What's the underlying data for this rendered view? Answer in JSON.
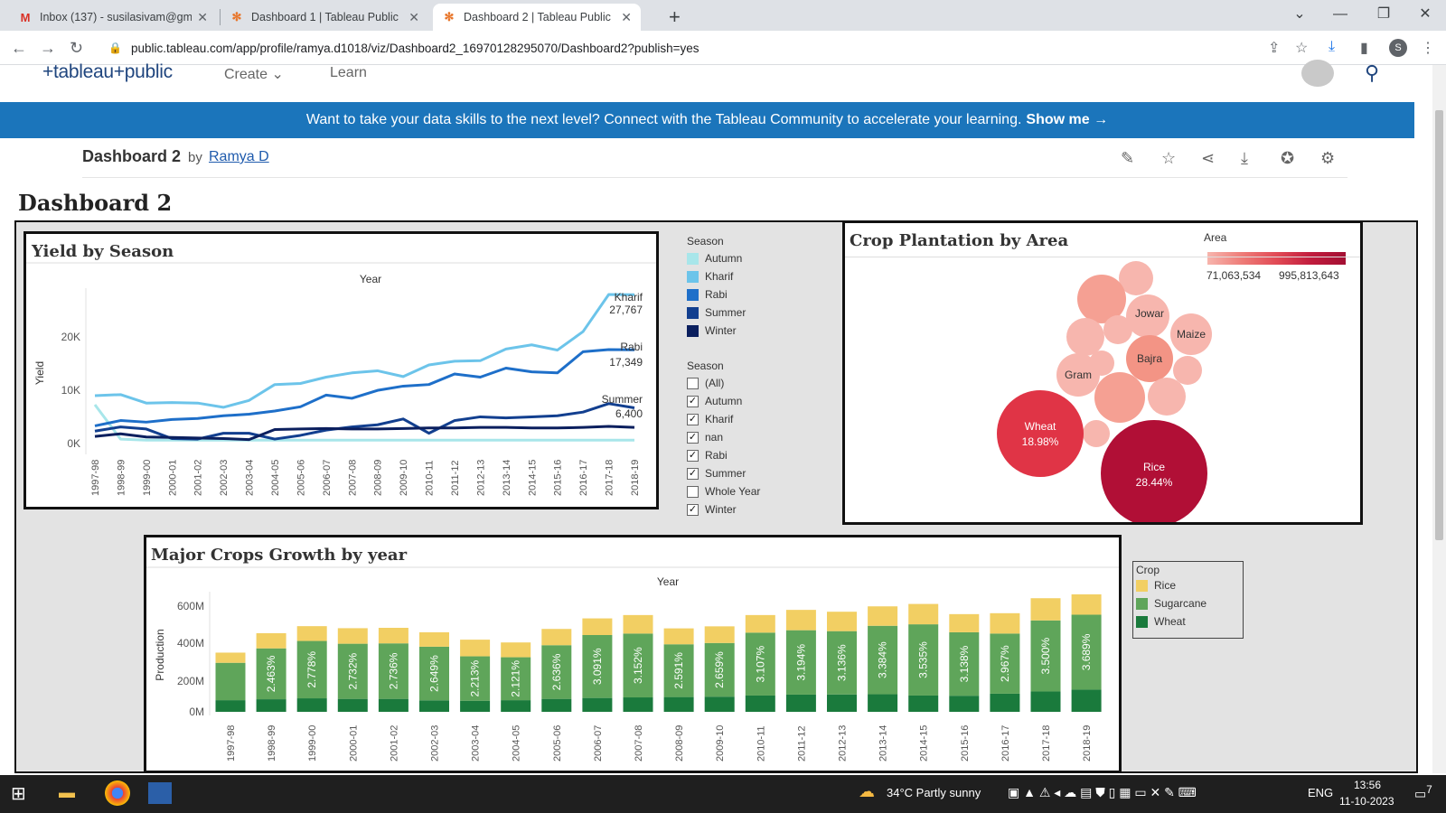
{
  "browser": {
    "tabs": [
      {
        "label": "Inbox (137) - susilasivam@gmail",
        "icon": "gmail-icon",
        "active": false
      },
      {
        "label": "Dashboard 1 | Tableau Public",
        "icon": "tableau-icon",
        "active": false
      },
      {
        "label": "Dashboard 2 | Tableau Public",
        "icon": "tableau-icon",
        "active": true
      }
    ],
    "url": "public.tableau.com/app/profile/ramya.d1018/viz/Dashboard2_16970128295070/Dashboard2?publish=yes",
    "profile_initial": "S"
  },
  "site": {
    "logo": "+tableau+public",
    "nav": [
      "Create",
      "Learn"
    ],
    "banner_text": "Want to take your data skills to the next level? Connect with the Tableau Community to accelerate your learning.",
    "banner_cta": "Show me →"
  },
  "viz": {
    "title": "Dashboard 2",
    "by": "by",
    "author": "Ramya D",
    "dashboard_title": "Dashboard 2"
  },
  "yield_panel": {
    "title": "Yield by Season",
    "axis_title": "Year",
    "ylabel": "Yield",
    "yticks": [
      "20K",
      "10K",
      "0K"
    ],
    "end_labels": [
      {
        "series": "Kharif",
        "name": "Kharif",
        "value": "27,767"
      },
      {
        "series": "Rabi",
        "name": "Rabi",
        "value": "17,349"
      },
      {
        "series": "Summer",
        "name": "Summer",
        "value": "6,400"
      }
    ]
  },
  "season_color_legend": {
    "title": "Season",
    "items": [
      {
        "label": "Autumn",
        "color": "#a8e6ea"
      },
      {
        "label": "Kharif",
        "color": "#6cc4ea"
      },
      {
        "label": "Rabi",
        "color": "#1e6fc9"
      },
      {
        "label": "Summer",
        "color": "#123f8f"
      },
      {
        "label": "Winter",
        "color": "#0b1f5e"
      }
    ]
  },
  "season_filter": {
    "title": "Season",
    "items": [
      {
        "label": "(All)",
        "checked": false
      },
      {
        "label": "Autumn",
        "checked": true
      },
      {
        "label": "Kharif",
        "checked": true
      },
      {
        "label": "nan",
        "checked": true
      },
      {
        "label": "Rabi",
        "checked": true
      },
      {
        "label": "Summer",
        "checked": true
      },
      {
        "label": "Whole Year",
        "checked": false
      },
      {
        "label": "Winter",
        "checked": true
      }
    ]
  },
  "area_panel": {
    "title": "Crop Plantation by Area",
    "legend_title": "Area",
    "legend_min": "71,063,534",
    "legend_max": "995,813,643",
    "labels": {
      "rice_name": "Rice",
      "rice_pct": "28.44%",
      "wheat_name": "Wheat",
      "wheat_pct": "18.98%",
      "jowar": "Jowar",
      "maize": "Maize",
      "bajra": "Bajra",
      "gram": "Gram"
    }
  },
  "crops_panel": {
    "title": "Major Crops Growth by year",
    "axis_title": "Year",
    "ylabel": "Production",
    "yticks": [
      "600M",
      "400M",
      "200M",
      "0M"
    ]
  },
  "crop_legend": {
    "title": "Crop",
    "items": [
      {
        "label": "Rice",
        "color": "#f2cf63"
      },
      {
        "label": "Sugarcane",
        "color": "#5fa55a"
      },
      {
        "label": "Wheat",
        "color": "#1a7a3c"
      }
    ]
  },
  "chart_data": [
    {
      "type": "line",
      "title": "Yield by Season",
      "xlabel": "Year",
      "ylabel": "Yield",
      "ylim": [
        0,
        29000
      ],
      "categories": [
        "1997-98",
        "1998-99",
        "1999-00",
        "2000-01",
        "2001-02",
        "2002-03",
        "2003-04",
        "2004-05",
        "2005-06",
        "2006-07",
        "2007-08",
        "2008-09",
        "2009-10",
        "2010-11",
        "2011-12",
        "2012-13",
        "2013-14",
        "2014-15",
        "2015-16",
        "2016-17",
        "2017-18",
        "2018-19"
      ],
      "series": [
        {
          "name": "Autumn",
          "color": "#a8e6ea",
          "values": [
            7000,
            500,
            300,
            300,
            300,
            300,
            300,
            300,
            300,
            300,
            300,
            300,
            300,
            300,
            300,
            300,
            300,
            300,
            300,
            300,
            300,
            300
          ]
        },
        {
          "name": "Kharif",
          "color": "#6cc4ea",
          "values": [
            8700,
            8900,
            7300,
            7400,
            7300,
            6500,
            7800,
            10800,
            11000,
            12200,
            13000,
            13400,
            12300,
            14500,
            15200,
            15300,
            17500,
            18300,
            17300,
            20800,
            27800,
            27767
          ]
        },
        {
          "name": "Rabi",
          "color": "#1e6fc9",
          "values": [
            3000,
            4000,
            3700,
            4200,
            4400,
            4900,
            5200,
            5800,
            6600,
            8800,
            8200,
            9700,
            10500,
            10800,
            12800,
            12200,
            13900,
            13200,
            13000,
            17000,
            17400,
            17349
          ]
        },
        {
          "name": "Summer",
          "color": "#123f8f",
          "values": [
            2000,
            2800,
            2400,
            600,
            500,
            1600,
            1600,
            500,
            1200,
            2200,
            2800,
            3200,
            4300,
            1600,
            4000,
            4700,
            4500,
            4700,
            4900,
            5600,
            7200,
            6400
          ]
        },
        {
          "name": "Winter",
          "color": "#0b1f5e",
          "values": [
            1000,
            1500,
            900,
            800,
            700,
            600,
            400,
            2300,
            2400,
            2500,
            2400,
            2400,
            2500,
            2600,
            2600,
            2700,
            2700,
            2600,
            2600,
            2700,
            2900,
            2700
          ]
        }
      ]
    },
    {
      "type": "bubble",
      "title": "Crop Plantation by Area",
      "legend": "Area",
      "color_range": [
        71063534,
        995813643
      ],
      "bubbles": [
        {
          "label": "Rice",
          "pct": "28.44%",
          "value": 995813643
        },
        {
          "label": "Wheat",
          "pct": "18.98%",
          "value": 664000000
        },
        {
          "label": "Bajra",
          "value": 170000000
        },
        {
          "label": "Gram",
          "value": 150000000
        },
        {
          "label": "Jowar",
          "value": 155000000
        },
        {
          "label": "Maize",
          "value": 120000000
        }
      ]
    },
    {
      "type": "bar",
      "stacked": true,
      "title": "Major Crops Growth by year",
      "xlabel": "Year",
      "ylabel": "Production",
      "ylim": [
        0,
        680
      ],
      "categories": [
        "1997-98",
        "1998-99",
        "1999-00",
        "2000-01",
        "2001-02",
        "2002-03",
        "2003-04",
        "2004-05",
        "2005-06",
        "2006-07",
        "2007-08",
        "2008-09",
        "2009-10",
        "2010-11",
        "2011-12",
        "2012-13",
        "2013-14",
        "2014-15",
        "2015-16",
        "2016-17",
        "2017-18",
        "2018-19"
      ],
      "series": [
        {
          "name": "Wheat",
          "color": "#1a7a3c",
          "values": [
            63,
            68,
            73,
            70,
            70,
            62,
            60,
            63,
            70,
            75,
            78,
            80,
            82,
            88,
            93,
            94,
            95,
            88,
            87,
            98,
            110,
            120
          ]
        },
        {
          "name": "Sugarcane",
          "color": "#5fa55a",
          "values": [
            202,
            275,
            310,
            298,
            300,
            290,
            240,
            232,
            290,
            340,
            345,
            285,
            290,
            340,
            348,
            342,
            370,
            385,
            343,
            325,
            384,
            405
          ]
        },
        {
          "name": "Rice",
          "color": "#f2cf63",
          "values": [
            55,
            82,
            80,
            84,
            84,
            78,
            90,
            80,
            88,
            90,
            100,
            86,
            90,
            95,
            110,
            105,
            105,
            110,
            98,
            110,
            120,
            110
          ]
        }
      ],
      "bar_labels": [
        "",
        "2.463%",
        "2.778%",
        "2.732%",
        "2.736%",
        "2.649%",
        "2.213%",
        "2.121%",
        "2.636%",
        "3.091%",
        "3.152%",
        "2.591%",
        "2.659%",
        "3.107%",
        "3.194%",
        "3.136%",
        "3.384%",
        "3.535%",
        "3.138%",
        "2.967%",
        "3.500%",
        "3.689%"
      ]
    }
  ],
  "taskbar": {
    "weather": "34°C  Partly sunny",
    "lang": "ENG",
    "time": "13:56",
    "date": "11-10-2023",
    "notif": "7"
  }
}
